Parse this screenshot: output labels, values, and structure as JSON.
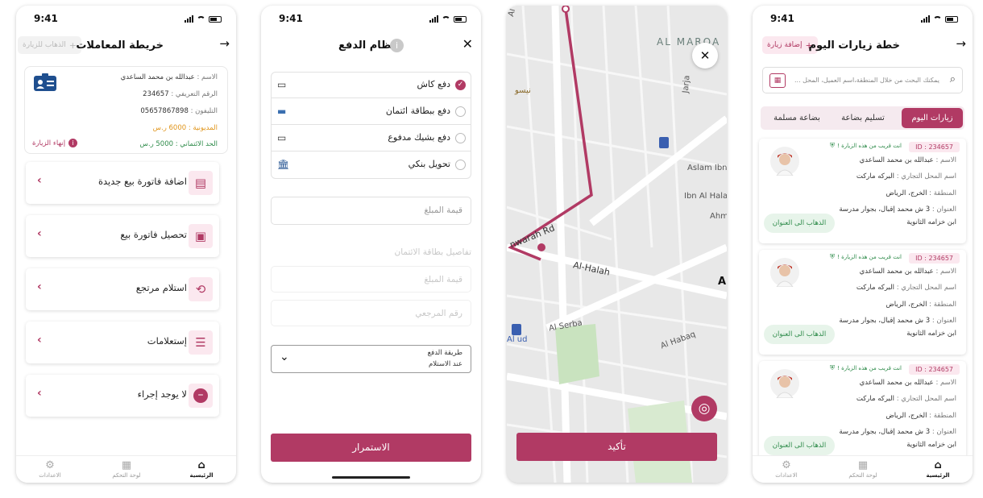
{
  "status": {
    "time": "9:41"
  },
  "colors": {
    "accent": "#b13a64",
    "accent_light": "#fbe8ef",
    "success": "#2e8b4a",
    "map_route": "#b13a64"
  },
  "screen1": {
    "title": "خريطة المعاملات",
    "visit_chip": "الذهاب للزيارة",
    "info": {
      "name_label": "الاسم :",
      "name": "عبدالله بن محمد الساعدي",
      "id_label": "الرقم التعريفي :",
      "id": "234657",
      "phone_label": "التليفون :",
      "phone": "05657867898",
      "debt_label": "المديونية :",
      "debt": "6000 ر.س",
      "credit_label": "الحد الائتماني :",
      "credit": "5000 ر.س",
      "end_visit": "إنهاء الزيارة"
    },
    "menu": [
      {
        "label": "اضافة فاتورة بيع جديدة",
        "icon": "invoice-icon"
      },
      {
        "label": "تحصيل فاتورة بيع",
        "icon": "cash-icon"
      },
      {
        "label": "استلام مرتجع",
        "icon": "return-icon"
      },
      {
        "label": "إستعلامات",
        "icon": "list-icon"
      },
      {
        "label": "لا يوجد إجراء",
        "icon": "minus-icon"
      }
    ]
  },
  "tabbar": {
    "settings": "الاعدادات",
    "dashboard": "لوحة التحكم",
    "home": "الرئيسية"
  },
  "screen2": {
    "title": "نظام الدفع",
    "options": [
      {
        "label": "دفع كاش",
        "selected": true
      },
      {
        "label": "دفع ببطاقة ائتمان",
        "selected": false
      },
      {
        "label": "دفع بشيك مدفوع",
        "selected": false
      },
      {
        "label": "تحويل بنكي",
        "selected": false
      }
    ],
    "amount_placeholder": "قيمة المبلغ",
    "card_details_label": "تفاصيل بطاقة الائتمان",
    "card_amount_placeholder": "قيمة المبلغ",
    "reference_placeholder": "رقم المرجعي",
    "method_label": "طريقة الدفع",
    "method_value": "عند الاستلام",
    "continue": "الاستمرار"
  },
  "screen3": {
    "labels": {
      "marqa": "AL MARQA",
      "taraf": "Al Taraf",
      "jarja": "Jarja",
      "nisso": "نيسو",
      "aslam": "Aslam Ibn",
      "halaw": "Ibn Al Halaw",
      "ahm": "Ahm",
      "nawarah": "nwarah Rd",
      "halah": "Al-Halah",
      "serba": "Al Serba",
      "habaq": "Al Habaq",
      "alud": "Al ud",
      "a": "A"
    },
    "confirm": "تأكيد"
  },
  "screen4": {
    "title": "خطة زيارات اليوم",
    "add_visit": "إضافة زيارة",
    "search_placeholder": "يمكنك البحث من خلال المنطقة،اسم العميل، المحل ...",
    "tabs": [
      "زيارات اليوم",
      "تسليم بضاعة",
      "بضاعة مسلمة"
    ],
    "visits": [
      {
        "id": "ID : 234657",
        "near": "انت قريب من هذه الزيارة !",
        "name_label": "الاسم :",
        "name": "عبدالله بن محمد الساعدي",
        "shop_label": "اسم المحل التجاري :",
        "shop": "البركه ماركت",
        "region_label": "المنطقة :",
        "region": "الخرج، الرياض",
        "address_label": "العنوان :",
        "address": "3 ش محمد إقبال، بجوار مدرسة",
        "address2": "ابن خزامه الثانوية",
        "go": "الذهاب الى العنوان"
      },
      {
        "id": "ID : 234657",
        "near": "انت قريب من هذه الزيارة !",
        "name_label": "الاسم :",
        "name": "عبدالله بن محمد الساعدي",
        "shop_label": "اسم المحل التجاري :",
        "shop": "البركه ماركت",
        "region_label": "المنطقة :",
        "region": "الخرج، الرياض",
        "address_label": "العنوان :",
        "address": "3 ش محمد إقبال، بجوار مدرسة",
        "address2": "ابن خزامه الثانوية",
        "go": "الذهاب الى العنوان"
      },
      {
        "id": "ID : 234657",
        "near": "انت قريب من هذه الزيارة !",
        "name_label": "الاسم :",
        "name": "عبدالله بن محمد الساعدي",
        "shop_label": "اسم المحل التجاري :",
        "shop": "البركه ماركت",
        "region_label": "المنطقة :",
        "region": "الخرج، الرياض",
        "address_label": "العنوان :",
        "address": "3 ش محمد إقبال، بجوار مدرسة",
        "address2": "ابن خزامه الثانوية",
        "go": "الذهاب الى العنوان"
      }
    ]
  }
}
